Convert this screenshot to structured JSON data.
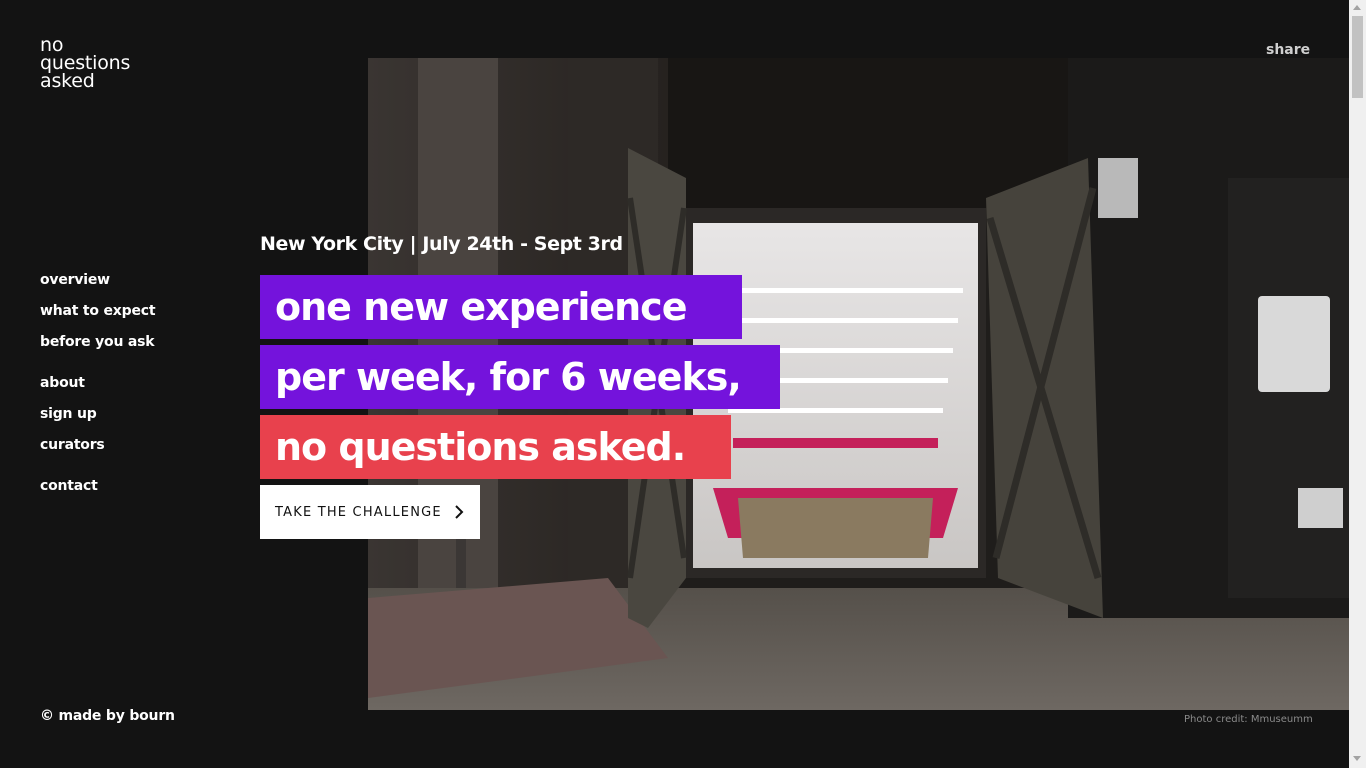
{
  "brand": {
    "logo_lines": [
      "no",
      "questions",
      "asked"
    ]
  },
  "header": {
    "share_label": "share"
  },
  "nav": {
    "items": [
      {
        "label": "overview"
      },
      {
        "label": "what to expect"
      },
      {
        "label": "before you ask"
      },
      {
        "label": "about"
      },
      {
        "label": "sign up"
      },
      {
        "label": "curators"
      },
      {
        "label": "contact"
      }
    ]
  },
  "footer": {
    "copyright": "© made by bourn",
    "photo_credit": "Photo credit: Mmuseumm"
  },
  "hero": {
    "location_dates": "New York City | July 24th - Sept 3rd",
    "headline": [
      "one new experience",
      "per week, for 6 weeks,",
      "no questions asked."
    ],
    "cta_label": "TAKE THE CHALLENGE",
    "cta_icon": "chevron-right-icon",
    "image_subject": "storefront-photo"
  },
  "colors": {
    "background": "#131313",
    "purple": "#7413dc",
    "red": "#e8414d",
    "white": "#ffffff"
  }
}
